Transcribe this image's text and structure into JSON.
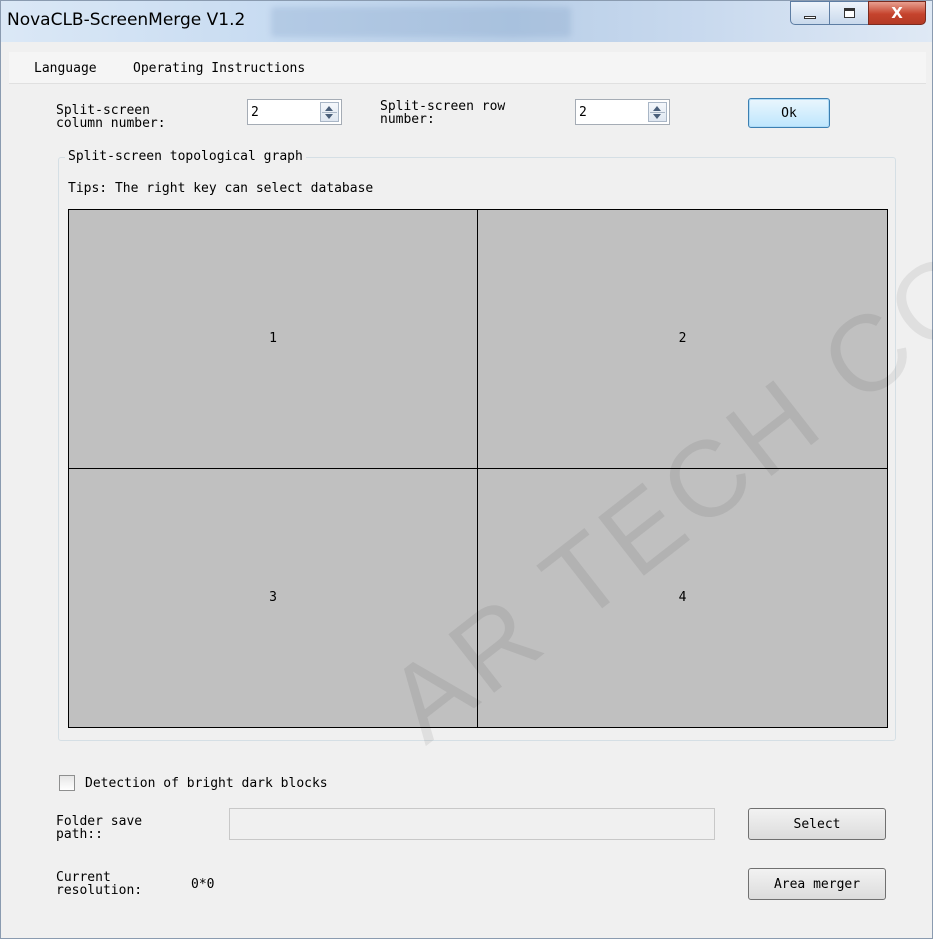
{
  "window": {
    "title": "NovaCLB-ScreenMerge V1.2",
    "controls": {
      "minimize_icon": "minimize-icon",
      "maximize_icon": "maximize-icon",
      "close_label": "X"
    }
  },
  "menu": {
    "items": [
      {
        "label": "Language"
      },
      {
        "label": "Operating Instructions"
      }
    ]
  },
  "split": {
    "column_label_line1": "Split-screen",
    "column_label_line2": "column number:",
    "column_value": "2",
    "row_label_line1": "Split-screen row",
    "row_label_line2": "number:",
    "row_value": "2",
    "ok_label": "Ok"
  },
  "topology": {
    "group_title": "Split-screen topological graph",
    "tips": "Tips: The right key can select database",
    "cells": [
      "1",
      "2",
      "3",
      "4"
    ]
  },
  "bottom": {
    "detection_label": "Detection of bright dark blocks",
    "detection_checked": false,
    "folder_label_line1": "Folder save",
    "folder_label_line2": "path::",
    "folder_value": "",
    "select_label": "Select",
    "resolution_label_line1": "Current",
    "resolution_label_line2": "resolution:",
    "resolution_value": "0*0",
    "area_merger_label": "Area merger"
  },
  "watermark": "AR TECH CO.,"
}
